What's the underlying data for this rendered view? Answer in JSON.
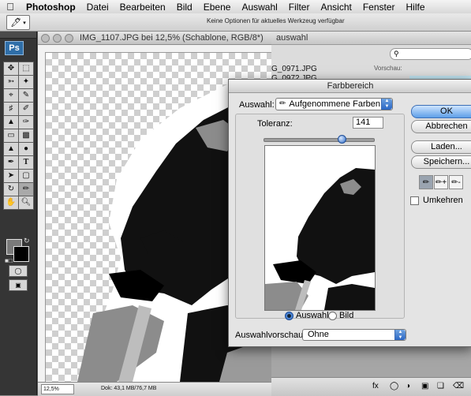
{
  "menubar": {
    "apple_icon": "apple-logo-icon",
    "app_name": "Photoshop",
    "menus": [
      "Datei",
      "Bearbeiten",
      "Bild",
      "Ebene",
      "Auswahl",
      "Filter",
      "Ansicht",
      "Fenster",
      "Hilfe"
    ]
  },
  "options_bar": {
    "tool_icon": "eyedropper-icon",
    "hint": "Keine Optionen für aktuelles Werkzeug verfügbar"
  },
  "tools": {
    "logo": "Ps",
    "items": [
      "move-icon",
      "marquee-icon",
      "lasso-icon",
      "quick-select-icon",
      "crop-icon",
      "slice-icon",
      "healing-icon",
      "brush-icon",
      "clone-stamp-icon",
      "history-brush-icon",
      "eraser-icon",
      "gradient-icon",
      "blur-icon",
      "dodge-icon",
      "pen-icon",
      "type-icon",
      "path-select-icon",
      "shape-icon",
      "3d-rotate-icon",
      "3d-orbit-icon",
      "hand-icon",
      "zoom-icon"
    ],
    "foreground_color": "#7a7a7a",
    "background_color": "#000000"
  },
  "document": {
    "title": "IMG_1107.JPG bei 12,5% (Schablone, RGB/8*)",
    "zoom": "12,5%",
    "doc_info": "Dok: 43,1 MB/76,7 MB"
  },
  "browser": {
    "title": "auswahl",
    "files": [
      "G_0971.JPG",
      "G_0972.JPG"
    ],
    "preview_label": "Vorschau:"
  },
  "dialog": {
    "title": "Farbbereich",
    "auswahl_label": "Auswahl:",
    "auswahl_value": "Aufgenommene Farben",
    "toleranz_label": "Toleranz:",
    "toleranz_value": "141",
    "toleranz_max": 200,
    "radio_auswahl": "Auswahl",
    "radio_bild": "Bild",
    "selected_radio": "Auswahl",
    "vorschau_label": "Auswahlvorschau:",
    "vorschau_value": "Ohne",
    "buttons": {
      "ok": "OK",
      "cancel": "Abbrechen",
      "load": "Laden...",
      "save": "Speichern..."
    },
    "eyedroppers": [
      "eyedropper-icon",
      "eyedropper-plus-icon",
      "eyedropper-minus-icon"
    ],
    "umkehren_label": "Umkehren",
    "umkehren_checked": false,
    "accent_color": "#2b69c6"
  }
}
